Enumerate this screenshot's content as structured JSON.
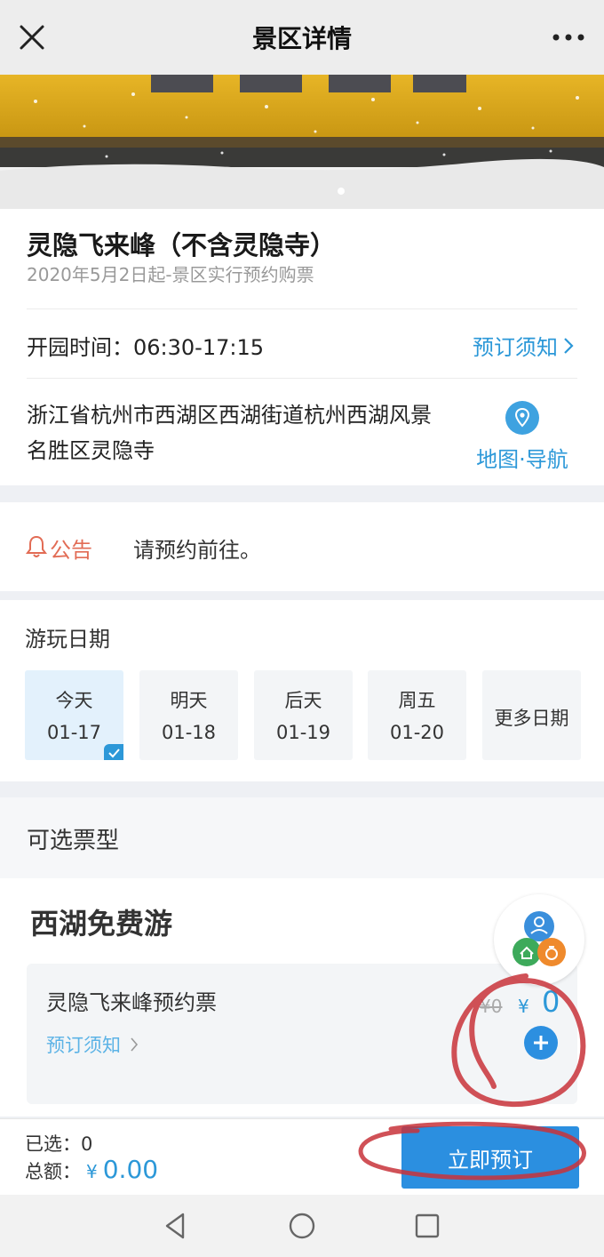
{
  "header": {
    "title": "景区详情",
    "close_icon": "close-icon",
    "more_icon": "more-icon"
  },
  "hero": {
    "description_icon": "hero-image"
  },
  "spot": {
    "name": "灵隐飞来峰（不含灵隐寺）",
    "subtitle": "2020年5月2日起-景区实行预约购票",
    "hours": "开园时间：06:30-17:15",
    "booking_notice_link": "预订须知",
    "address": "浙江省杭州市西湖区西湖街道杭州西湖风景名胜区灵隐寺",
    "map_nav": "地图·导航"
  },
  "notice": {
    "tag": "公告",
    "text": "请预约前往。"
  },
  "dates": {
    "heading": "游玩日期",
    "items": [
      {
        "day": "今天",
        "date": "01-17",
        "selected": true
      },
      {
        "day": "明天",
        "date": "01-18",
        "selected": false
      },
      {
        "day": "后天",
        "date": "01-19",
        "selected": false
      },
      {
        "day": "周五",
        "date": "01-20",
        "selected": false
      }
    ],
    "more": "更多日期"
  },
  "tickets": {
    "heading": "可选票型",
    "group_title": "西湖免费游",
    "items": [
      {
        "name": "灵隐飞来峰预约票",
        "notice": "预订须知",
        "original_price": "¥0",
        "currency": "¥",
        "price": "0"
      }
    ]
  },
  "footer": {
    "selected_label": "已选：0",
    "total_label": "总额：",
    "currency": "¥",
    "total": "0.00",
    "book_button": "立即预订"
  },
  "colors": {
    "accent": "#2c98d8",
    "button": "#2b8fe0",
    "notice": "#e26c55",
    "annotation": "#c8333a"
  }
}
